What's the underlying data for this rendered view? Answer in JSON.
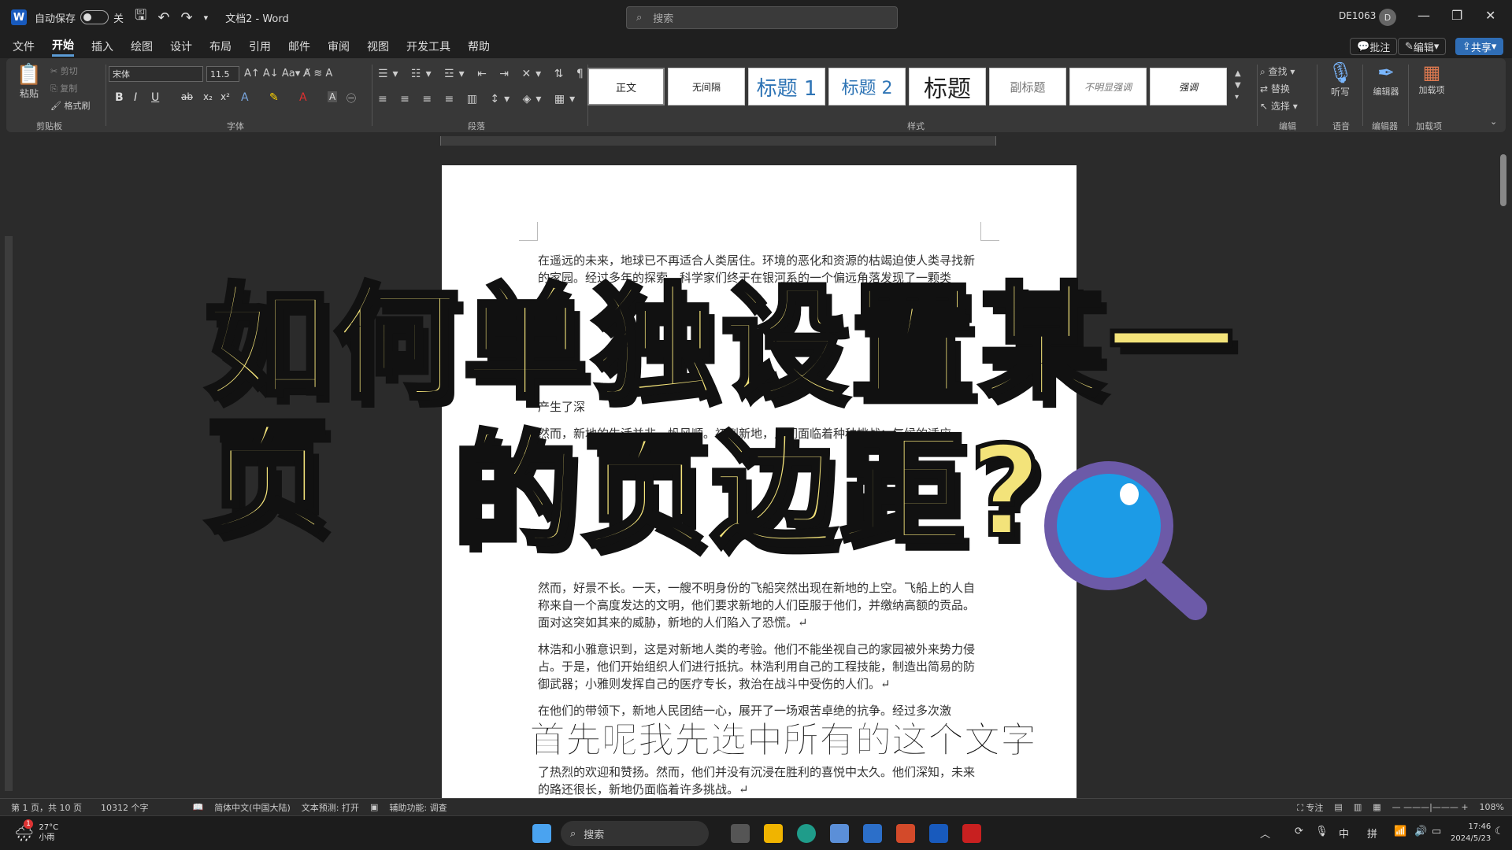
{
  "titlebar": {
    "autosave_label": "自动保存",
    "autosave_state": "关",
    "doc_title": "文档2 - Word",
    "search_placeholder": "搜索",
    "user_id": "DE1063",
    "user_initial": "D"
  },
  "menu": {
    "items": [
      "文件",
      "开始",
      "插入",
      "绘图",
      "设计",
      "布局",
      "引用",
      "邮件",
      "审阅",
      "视图",
      "开发工具",
      "帮助"
    ],
    "active": "开始",
    "right": [
      "批注",
      "编辑",
      "共享"
    ]
  },
  "ribbon": {
    "clipboard": {
      "paste": "粘贴",
      "cut": "剪切",
      "copy": "复制",
      "format_painter": "格式刷",
      "label": "剪贴板"
    },
    "font": {
      "family": "宋体",
      "size": "11.5",
      "label": "字体"
    },
    "paragraph": {
      "label": "段落"
    },
    "styles": {
      "items": [
        "正文",
        "无间隔",
        "标题 1",
        "标题 2",
        "标题",
        "副标题",
        "不明显强调",
        "强调"
      ],
      "label": "样式"
    },
    "editing": {
      "find": "查找",
      "replace": "替换",
      "select": "选择",
      "label": "编辑"
    },
    "voice": {
      "dictate": "听写",
      "label": "语音"
    },
    "editor": {
      "name": "编辑器",
      "label": "编辑器"
    },
    "addins": {
      "name": "加载项",
      "label": "加载项"
    }
  },
  "document": {
    "paragraphs": [
      "在遥远的未来，地球已不再适合人类居住。环境的恶化和资源的枯竭迫使人类寻找新的家园。经过多年的探索，科学家们终于在银河系的一个偏远角落发现了一颗类",
      "产生了深",
      "然而，新地的生活并非一帆风顺。初到新地，人们面临着种种挑战：气候的适应、",
      "然而，好景不长。一天，一艘不明身份的飞船突然出现在新地的上空。飞船上的人自称来自一个高度发达的文明，他们要求新地的人们臣服于他们，并缴纳高额的贡品。面对这突如其来的威胁，新地的人们陷入了恐慌。↵",
      "林浩和小雅意识到，这是对新地人类的考验。他们不能坐视自己的家园被外来势力侵占。于是，他们开始组织人们进行抵抗。林浩利用自己的工程技能，制造出简易的防御武器；小雅则发挥自己的医疗专长，救治在战斗中受伤的人们。↵",
      "在他们的带领下，新地人民团结一心，展开了一场艰苦卓绝的抗争。经过多次激",
      "了热烈的欢迎和赞扬。然而，他们并没有沉浸在胜利的喜悦中太久。他们深知，未来的路还很长，新地仍面临着许多挑战。↵"
    ]
  },
  "overlay": {
    "title_line1": "如何单独设置某一页",
    "title_line2": "的页边距?",
    "subtitle": "首先呢我先选中所有的这个文字"
  },
  "statusbar": {
    "page": "第 1 页，共 10 页",
    "words": "10312 个字",
    "language": "简体中文(中国大陆)",
    "text_predict": "文本预测: 打开",
    "accessibility": "辅助功能: 调查",
    "focus": "专注",
    "zoom": "108%"
  },
  "taskbar": {
    "weather_temp": "27°C",
    "weather_desc": "小雨",
    "weather_badge": "1",
    "search": "搜索",
    "ime1": "中",
    "ime2": "拼",
    "time": "17:46",
    "date": "2024/5/23"
  },
  "colors": {
    "accent": "#5b9bd5",
    "overlay_text": "#f3e37a",
    "magnifier_glass": "#1c9be6",
    "magnifier_ring": "#6c5aa8"
  }
}
